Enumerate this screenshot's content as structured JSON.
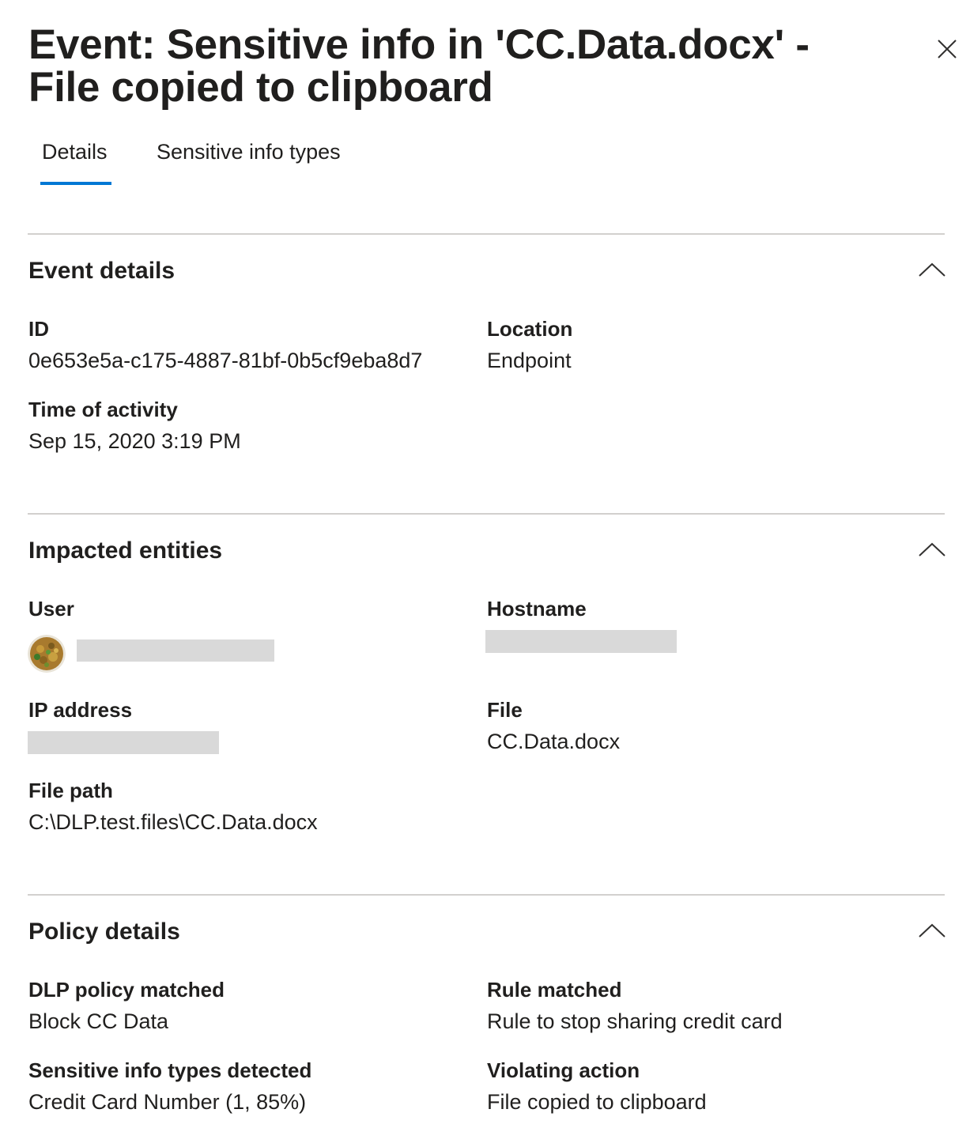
{
  "header": {
    "title": "Event: Sensitive info in 'CC.Data.docx' - File copied to clipboard",
    "close_icon": "close-icon"
  },
  "tabs": [
    {
      "label": "Details",
      "selected": true
    },
    {
      "label": "Sensitive info types",
      "selected": false
    }
  ],
  "accent_color": "#0078d4",
  "sections": {
    "event_details": {
      "title": "Event details",
      "id_label": "ID",
      "id_value": "0e653e5a-c175-4887-81bf-0b5cf9eba8d7",
      "location_label": "Location",
      "location_value": "Endpoint",
      "time_label": "Time of activity",
      "time_value": "Sep 15, 2020 3:19 PM"
    },
    "impacted_entities": {
      "title": "Impacted entities",
      "user_label": "User",
      "hostname_label": "Hostname",
      "ip_label": "IP address",
      "file_label": "File",
      "file_value": "CC.Data.docx",
      "file_path_label": "File path",
      "file_path_value": "C:\\DLP.test.files\\CC.Data.docx"
    },
    "policy_details": {
      "title": "Policy details",
      "dlp_policy_label": "DLP policy matched",
      "dlp_policy_value": "Block CC Data",
      "rule_label": "Rule matched",
      "rule_value": "Rule to stop sharing credit card",
      "sit_label": "Sensitive info types detected",
      "sit_value": "Credit Card Number (1, 85%)",
      "violating_label": "Violating action",
      "violating_value": "File copied to clipboard"
    }
  }
}
